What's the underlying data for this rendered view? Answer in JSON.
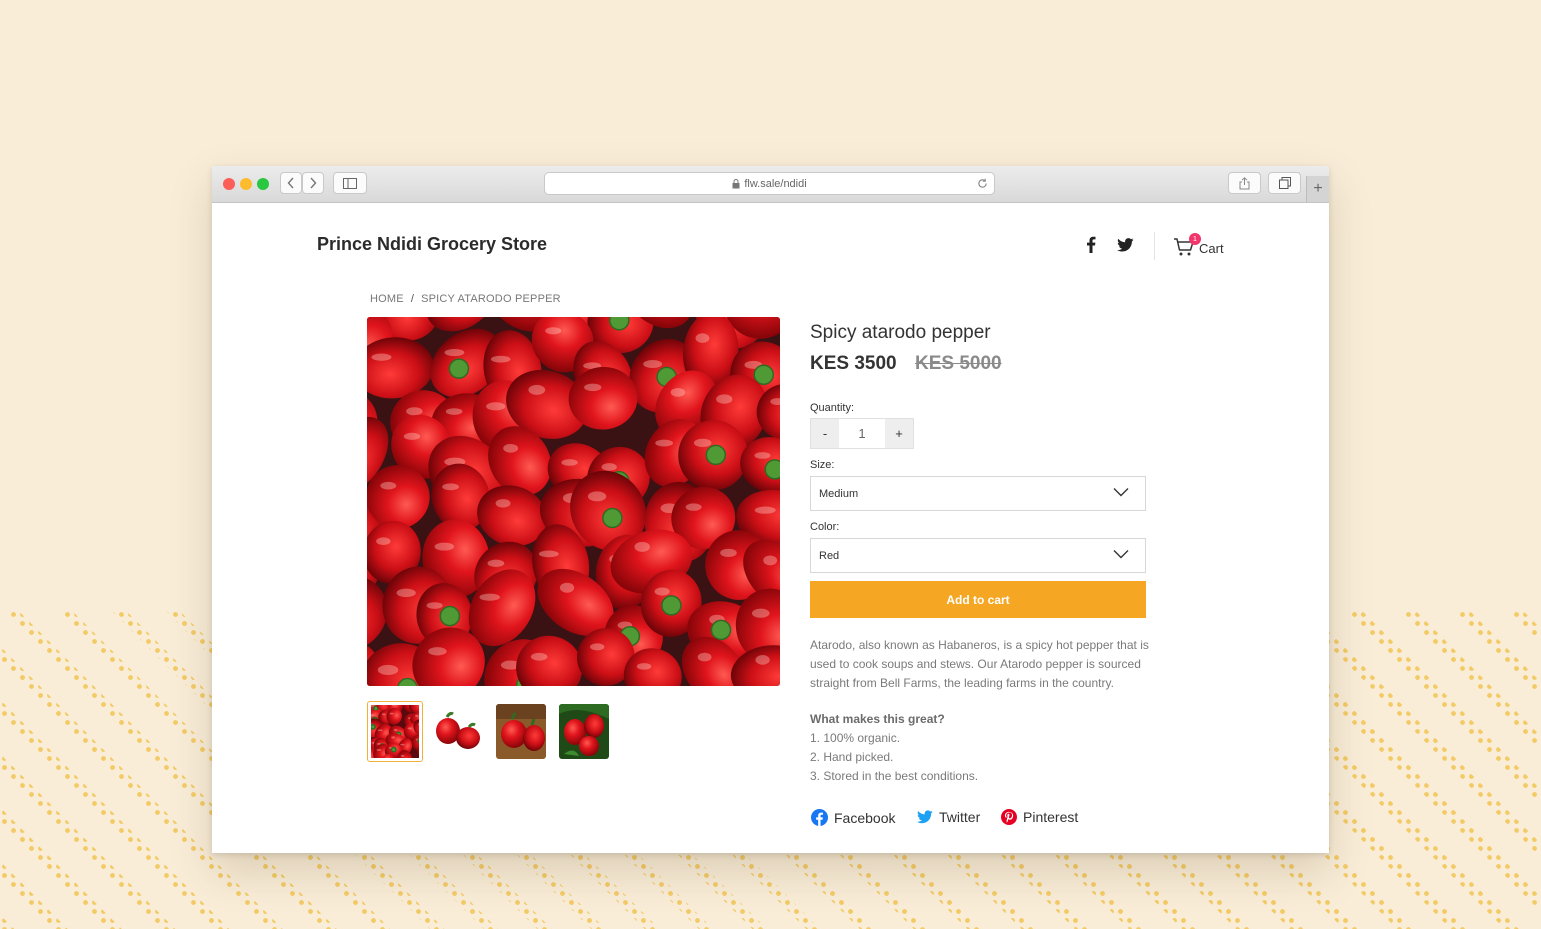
{
  "browser": {
    "url": "flw.sale/ndidi",
    "plus_label": "+"
  },
  "header": {
    "store_name": "Prince Ndidi Grocery Store",
    "cart_label": "Cart",
    "cart_count": "1"
  },
  "breadcrumb": {
    "home": "HOME",
    "separator": "/",
    "current": "SPICY ATARODO PEPPER"
  },
  "product": {
    "title": "Spicy atarodo pepper",
    "price": "KES 3500",
    "old_price": "KES 5000",
    "quantity_label": "Quantity:",
    "quantity_minus": "-",
    "quantity_value": "1",
    "quantity_plus": "+",
    "size_label": "Size:",
    "size_value": "Medium",
    "color_label": "Color:",
    "color_value": "Red",
    "add_to_cart": "Add to cart",
    "description": "Atarodo, also known as Habaneros, is a spicy hot pepper that is used to cook soups and stews. Our Atarodo pepper is sourced straight from Bell Farms, the leading farms in the country.",
    "features_title": "What makes this great?",
    "features": [
      "1. 100% organic.",
      "2. Hand picked.",
      "3. Stored in the best conditions."
    ]
  },
  "share": {
    "facebook": "Facebook",
    "twitter": "Twitter",
    "pinterest": "Pinterest"
  },
  "colors": {
    "accent": "#f5a623",
    "badge": "#f2356b",
    "facebook": "#1877f2",
    "twitter": "#1da1f2",
    "pinterest": "#e60023"
  }
}
